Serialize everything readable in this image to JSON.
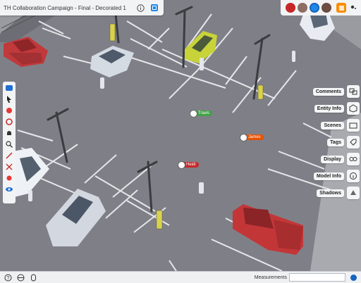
{
  "window": {
    "title": "TH Collaboration Campaign - Final - Decorated 1"
  },
  "collaborators": [
    {
      "name": "collaborator-1",
      "color": "#c62828"
    },
    {
      "name": "collaborator-2",
      "color": "#8d6e63"
    },
    {
      "name": "collaborator-3",
      "color": "#1e88e5"
    },
    {
      "name": "collaborator-4",
      "color": "#6d4c41"
    }
  ],
  "left_tools": [
    "scenes-icon",
    "select-icon",
    "paint-icon",
    "orbit-icon",
    "walk-icon",
    "zoom-icon",
    "measure-icon",
    "section-icon",
    "tag-icon",
    "eye-icon"
  ],
  "right_panel": {
    "items": [
      {
        "label": "Comments",
        "icon": "comments-icon"
      },
      {
        "label": "Entity Info",
        "icon": "entity-info-icon"
      },
      {
        "label": "Scenes",
        "icon": "scenes-icon"
      },
      {
        "label": "Tags",
        "icon": "tags-icon"
      },
      {
        "label": "Display",
        "icon": "display-icon"
      },
      {
        "label": "Model Info",
        "icon": "model-info-icon"
      },
      {
        "label": "Shadows",
        "icon": "shadows-icon"
      }
    ]
  },
  "people_tags": [
    {
      "name": "Travis",
      "color": "#43a047"
    },
    {
      "name": "James",
      "color": "#e65100"
    },
    {
      "name": "Heidi",
      "color": "#c62828"
    }
  ],
  "status_bar": {
    "measurements_label": "Measurements",
    "measurements_value": ""
  },
  "colors": {
    "asphalt": "#7f8087",
    "ui_bg": "#f2f3f5",
    "accent": "#1565c0"
  }
}
